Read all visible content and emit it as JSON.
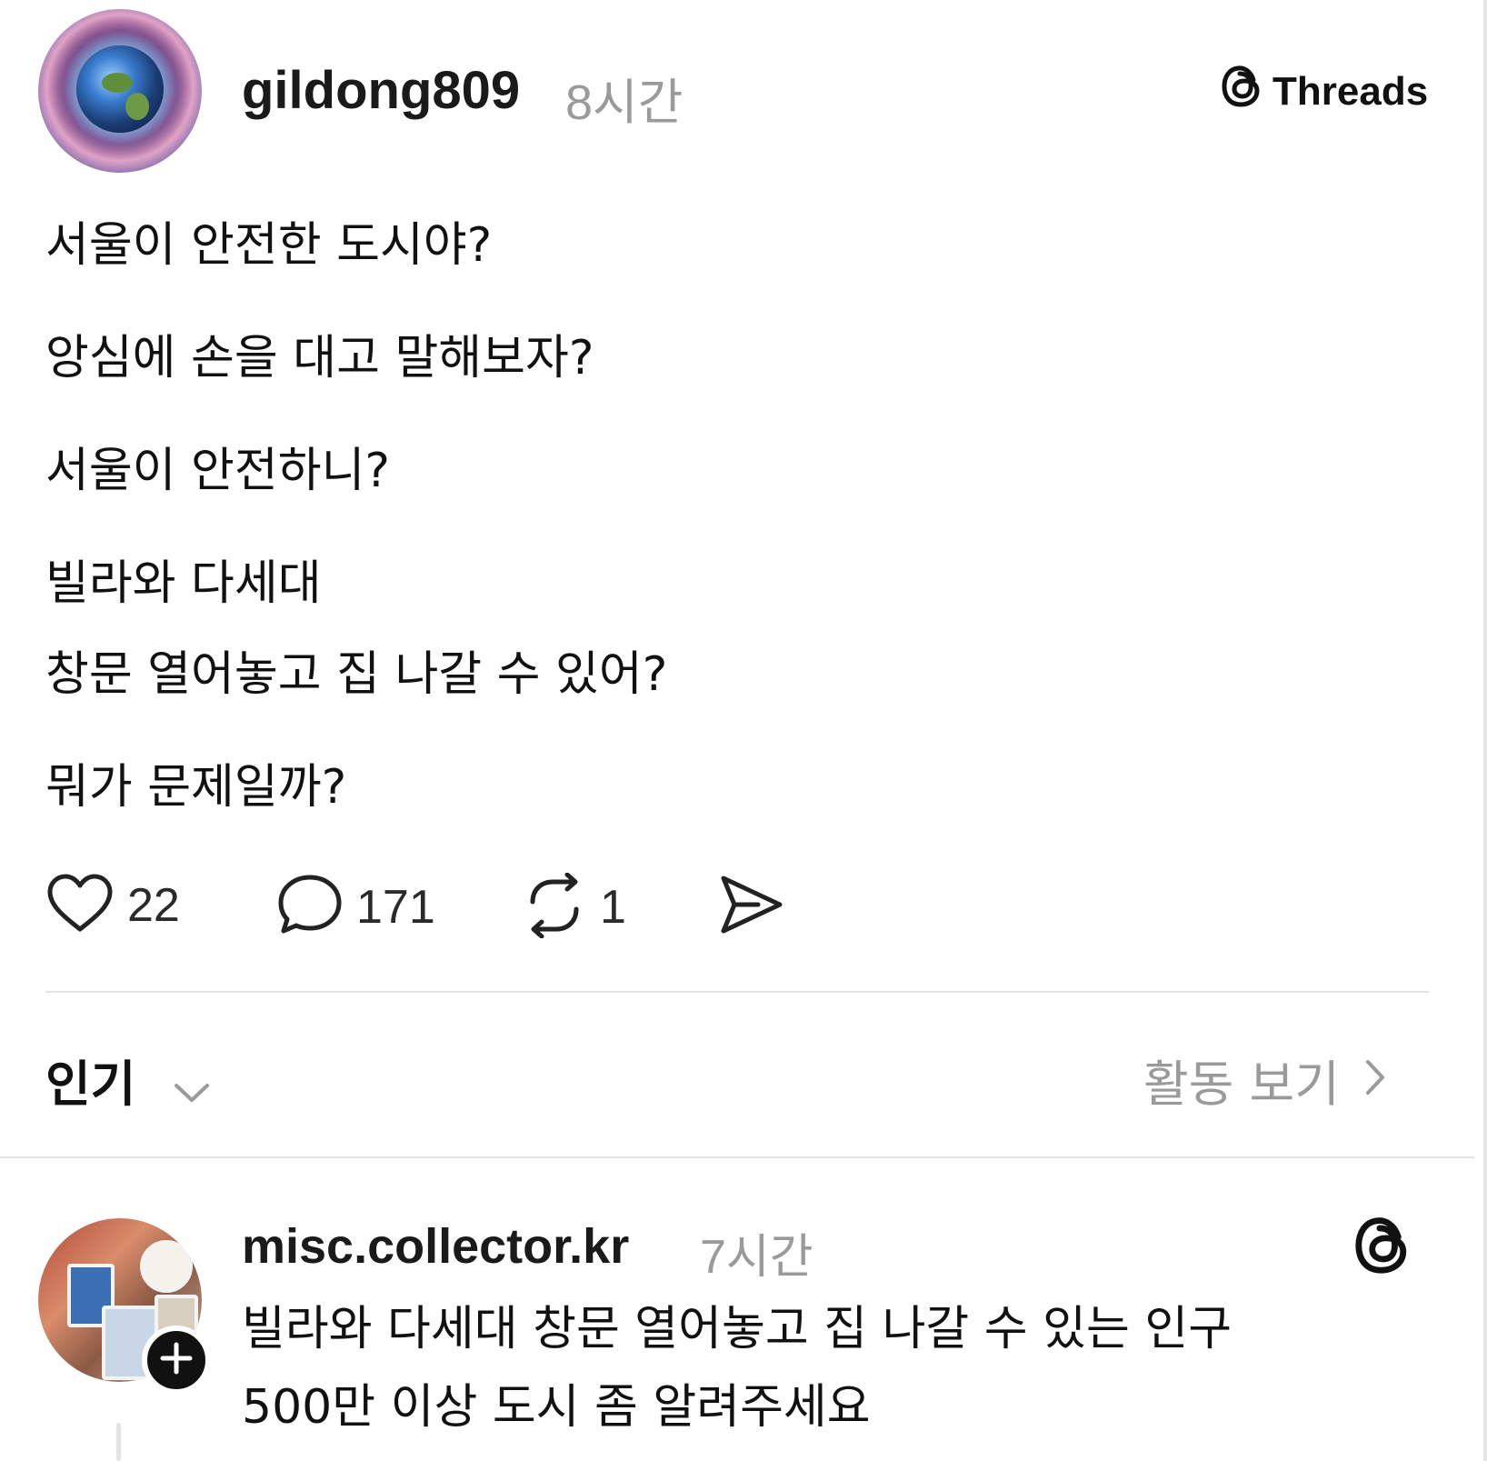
{
  "post": {
    "username": "gildong809",
    "time": "8시간",
    "brand": "Threads",
    "lines": [
      "서울이 안전한 도시야?",
      "앙심에 손을 대고 말해보자?",
      "서울이 안전하니?",
      "빌라와 다세대",
      "창문 열어놓고 집 나갈 수 있어?",
      "뭐가 문제일까?"
    ],
    "actions": {
      "likes": "22",
      "comments": "171",
      "reposts": "1"
    }
  },
  "sort": {
    "label": "인기",
    "activity_link": "활동 보기"
  },
  "reply": {
    "username": "misc.collector.kr",
    "time": "7시간",
    "lines": [
      "빌라와 다세대 창문 열어놓고 집 나갈 수 있는 인구",
      "500만 이상 도시 좀 알려주세요"
    ]
  },
  "icons": {
    "like": "heart-icon",
    "comment": "speech-bubble-icon",
    "repost": "repost-icon",
    "share": "send-icon",
    "sort": "chevron-down-icon",
    "activity": "chevron-right-icon",
    "brand": "threads-logo-icon",
    "follow": "plus-icon"
  }
}
